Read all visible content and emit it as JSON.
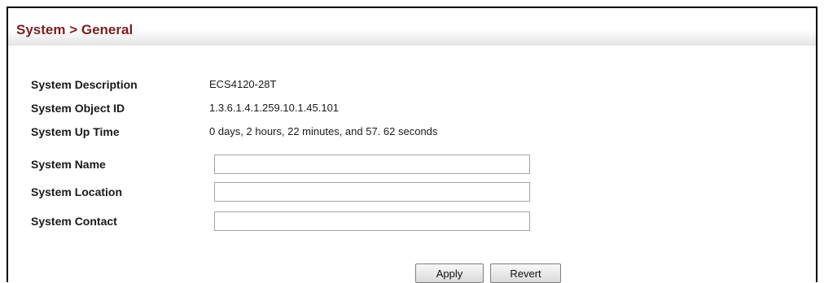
{
  "header": {
    "title": "System > General"
  },
  "info": {
    "system_description": {
      "label": "System Description",
      "value": "ECS4120-28T"
    },
    "system_object_id": {
      "label": "System Object ID",
      "value": "1.3.6.1.4.1.259.10.1.45.101"
    },
    "system_up_time": {
      "label": "System Up Time",
      "value": "0 days, 2 hours, 22 minutes, and 57. 62 seconds"
    }
  },
  "fields": {
    "system_name": {
      "label": "System Name",
      "value": ""
    },
    "system_location": {
      "label": "System Location",
      "value": ""
    },
    "system_contact": {
      "label": "System Contact",
      "value": ""
    }
  },
  "buttons": {
    "apply": "Apply",
    "revert": "Revert"
  },
  "colors": {
    "title": "#7a1f1f",
    "frame_border": "#000000",
    "input_border": "#a5a5a5"
  }
}
